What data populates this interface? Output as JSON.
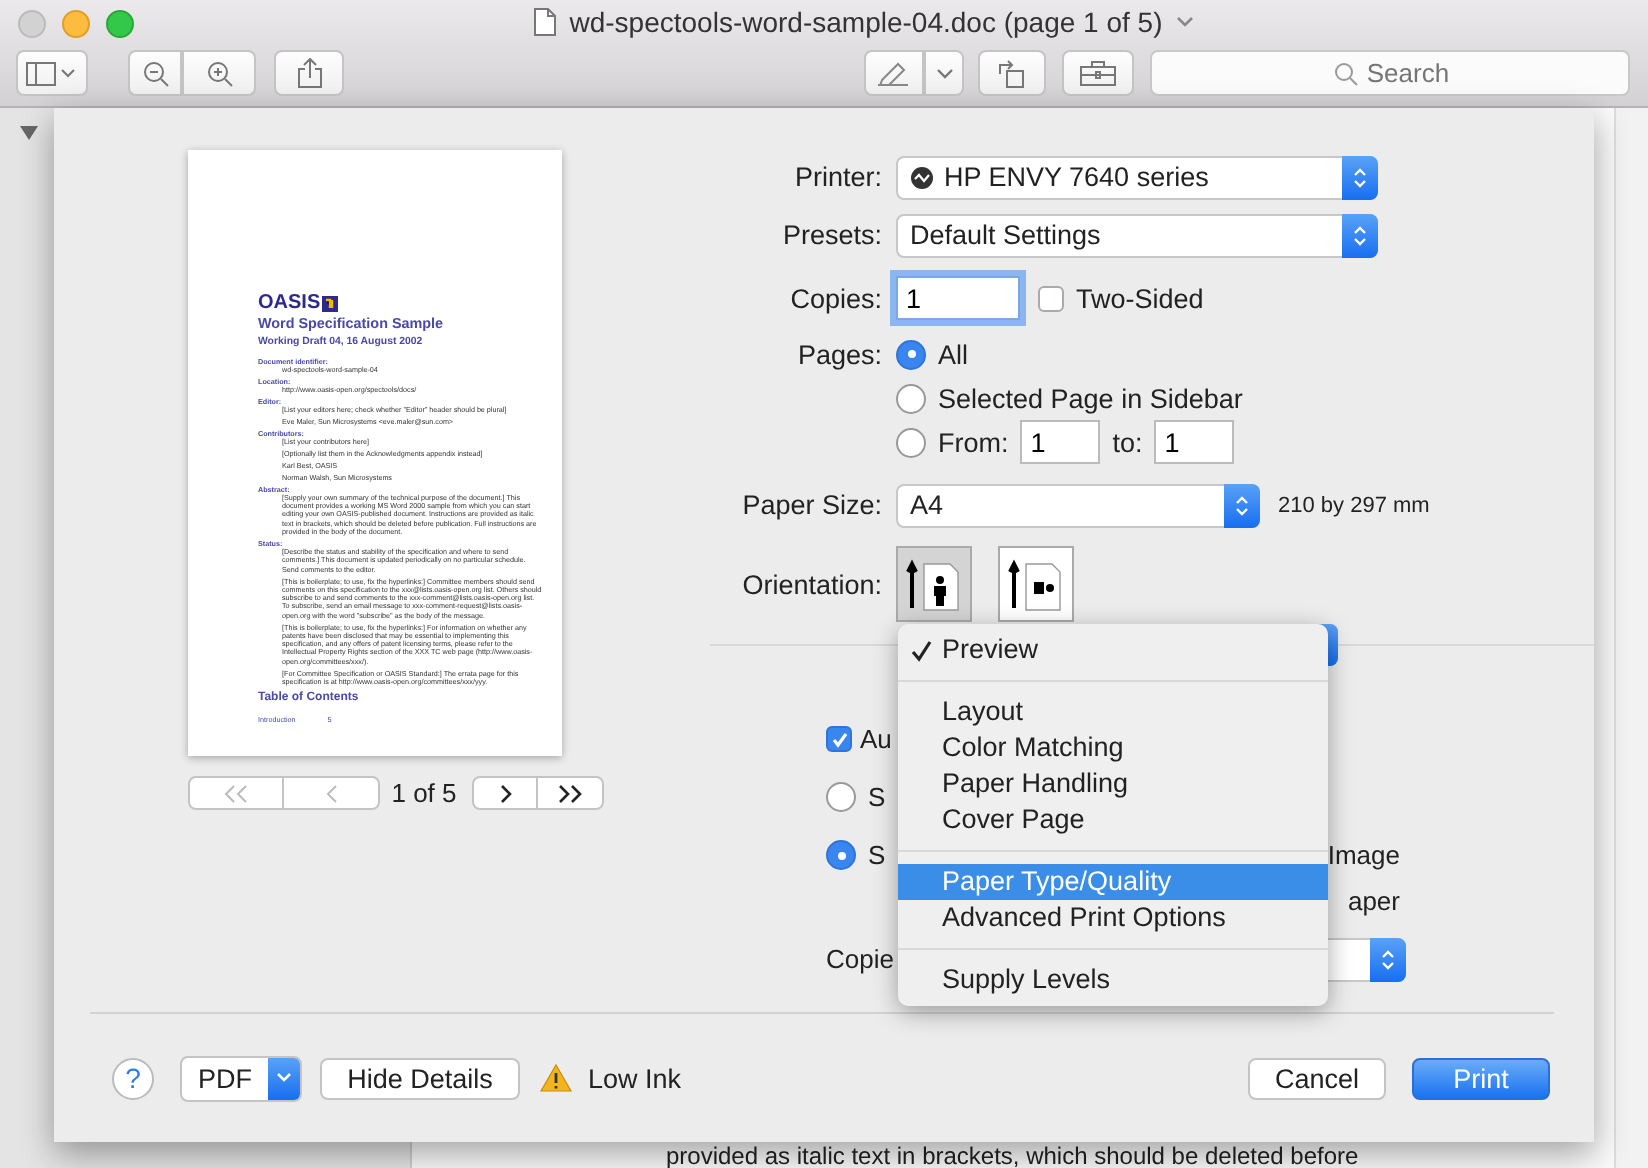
{
  "window": {
    "title": "wd-spectools-word-sample-04.doc (page 1 of 5)",
    "search": {
      "placeholder": "Search"
    }
  },
  "print_dialog": {
    "preview": {
      "document": {
        "logo": "OASIS",
        "title": "Word Specification Sample",
        "subtitle": "Working Draft 04, 16 August 2002",
        "sections": [
          {
            "label": "Document identifier:",
            "paragraphs": [
              "wd-spectools-word-sample-04"
            ]
          },
          {
            "label": "Location:",
            "paragraphs": [
              "http://www.oasis-open.org/spectools/docs/"
            ]
          },
          {
            "label": "Editor:",
            "paragraphs": [
              "[List your editors here; check whether \"Editor\" header should be plural]",
              "Eve Maler, Sun Microsystems <eve.maler@sun.com>"
            ]
          },
          {
            "label": "Contributors:",
            "paragraphs": [
              "[List your contributors here]",
              "[Optionally list them in the Acknowledgments appendix instead]",
              "Karl Best, OASIS",
              "Norman Walsh, Sun Microsystems"
            ]
          },
          {
            "label": "Abstract:",
            "paragraphs": [
              "[Supply your own summary of the technical purpose of the document.] This document provides a working MS Word 2000 sample from which you can start editing your own OASIS-published document. Instructions are provided as italic text in brackets, which should be deleted before publication. Full instructions are provided in the body of the document."
            ]
          },
          {
            "label": "Status:",
            "paragraphs": [
              "[Describe the status and stability of the specification and where to send comments.] This document is updated periodically on no particular schedule. Send comments to the editor.",
              "[This is boilerplate; to use, fix the hyperlinks:] Committee members should send comments on this specification to the xxx@lists.oasis-open.org list. Others should subscribe to and send comments to the xxx-comment@lists.oasis-open.org list. To subscribe, send an email message to xxx-comment-request@lists.oasis-open.org with the word \"subscribe\" as the body of the message.",
              "[This is boilerplate; to use, fix the hyperlinks:] For information on whether any patents have been disclosed that may be essential to implementing this specification, and any offers of patent licensing terms, please refer to the Intellectual Property Rights section of the XXX TC web page (http://www.oasis-open.org/committees/xxx/).",
              "[For Committee Specification or OASIS Standard:] The errata page for this specification is at http://www.oasis-open.org/committees/xxx/yyy."
            ]
          }
        ],
        "toc_heading": "Table of Contents",
        "toc_entries": [
          {
            "title": "Introduction",
            "page": "5"
          }
        ]
      },
      "page_indicator": "1 of 5"
    },
    "printer": {
      "label": "Printer:",
      "value": "HP ENVY 7640 series"
    },
    "presets": {
      "label": "Presets:",
      "value": "Default Settings"
    },
    "copies": {
      "label": "Copies:",
      "value": "1"
    },
    "two_sided": {
      "label": "Two-Sided",
      "checked": false
    },
    "pages": {
      "label": "Pages:",
      "options": [
        {
          "kind": "plain",
          "label": "All",
          "selected": true
        },
        {
          "kind": "plain",
          "label": "Selected Page in Sidebar",
          "selected": false
        },
        {
          "kind": "range",
          "label": "From:",
          "from": "1",
          "to_label": "to:",
          "to": "1",
          "selected": false
        }
      ]
    },
    "paper_size": {
      "label": "Paper Size:",
      "value": "A4",
      "dimensions": "210 by 297 mm"
    },
    "orientation": {
      "label": "Orientation:",
      "options": [
        {
          "kind": "portrait",
          "selected": true
        },
        {
          "kind": "landscape",
          "selected": false
        }
      ]
    },
    "pane_options": {
      "auto_checkbox": {
        "label": "Au",
        "checked": true
      },
      "scale_options": [
        {
          "label": "S",
          "selected": false
        },
        {
          "label": "S",
          "trailing": "Image",
          "selected": true
        }
      ],
      "extra_label": "aper",
      "copies_label": "Copie"
    },
    "pane_menu": {
      "groups": [
        [
          {
            "label": "Preview",
            "checked": true,
            "selected": false
          }
        ],
        [
          {
            "label": "Layout",
            "checked": false,
            "selected": false
          },
          {
            "label": "Color Matching",
            "checked": false,
            "selected": false
          },
          {
            "label": "Paper Handling",
            "checked": false,
            "selected": false
          },
          {
            "label": "Cover Page",
            "checked": false,
            "selected": false
          }
        ],
        [
          {
            "label": "Paper Type/Quality",
            "checked": false,
            "selected": true
          },
          {
            "label": "Advanced Print Options",
            "checked": false,
            "selected": false
          }
        ],
        [
          {
            "label": "Supply Levels",
            "checked": false,
            "selected": false
          }
        ]
      ]
    },
    "footer": {
      "help": "?",
      "pdf": "PDF",
      "hide_details": "Hide Details",
      "warning": "Low Ink",
      "cancel": "Cancel",
      "print": "Print"
    }
  },
  "background_text": "provided as italic text in brackets, which should be deleted before"
}
